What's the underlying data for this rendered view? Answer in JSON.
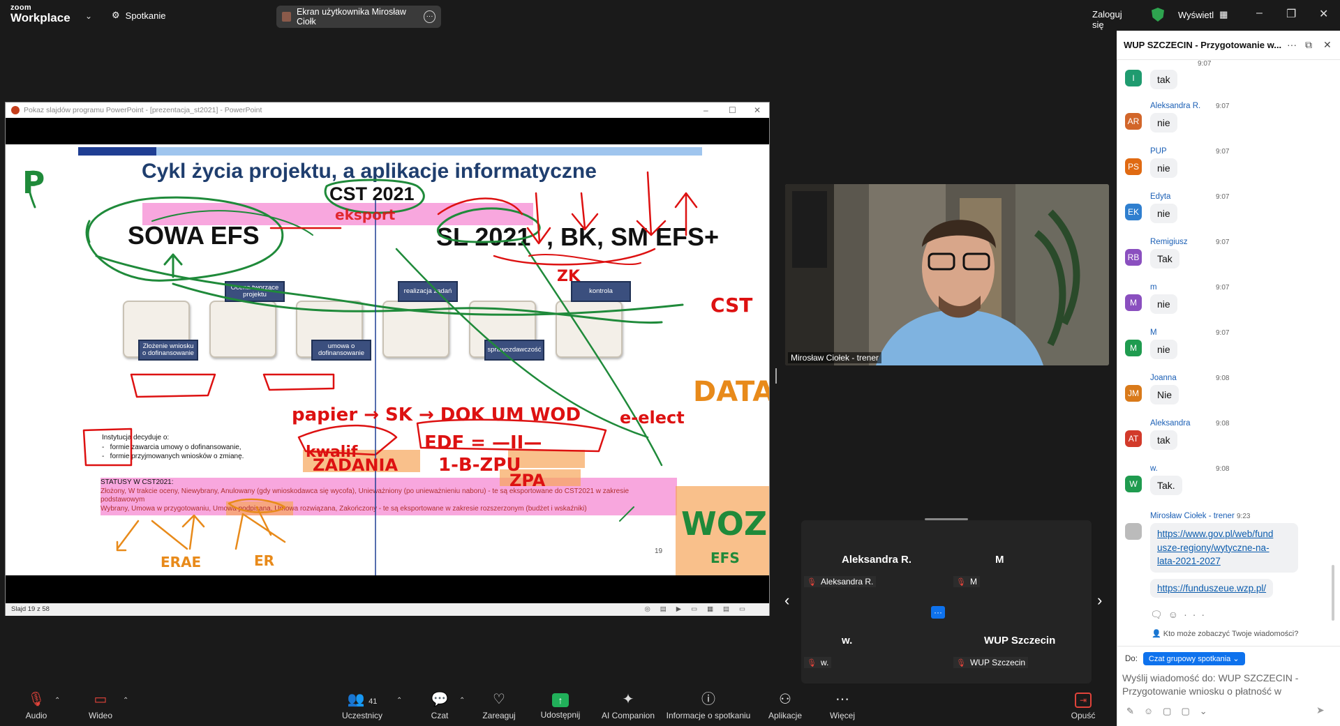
{
  "app": {
    "logo_top": "zoom",
    "logo_bottom": "Workplace",
    "meeting_label": "Spotkanie",
    "share_pill": "Ekran użytkownika Mirosław Ciołk",
    "signin": "Zaloguj się",
    "view": "Wyświetl"
  },
  "ppt": {
    "window_title": "Pokaz slajdów programu PowerPoint - [prezentacja_st2021] - PowerPoint",
    "status_left": "Slajd 19 z 58",
    "slide": {
      "title": "Cykl życia projektu, a aplikacje informatyczne",
      "cst": "CST 2021",
      "sowa": "SOWA EFS",
      "sl": "SL 2021",
      "bk": ", BK, SM EFS+",
      "stages": [
        "Złożenie wniosku o dofinansowanie",
        "Ocena tworzące projektu",
        "umowa o dofinansowanie",
        "realizacja zadań",
        "sprawozdawczość",
        "kontrola"
      ],
      "inst_title": "Instytucja decyduje o:",
      "inst_items": [
        "formie zawarcia umowy o dofinansowanie,",
        "formie przyjmowanych wniosków o zmianę."
      ],
      "statusy_title": "STATUSY W CST2021:",
      "statusy_line1": "Złożony, W trakcie oceny, Niewybrany, Anulowany (gdy wnioskodawca się wycofa), Unieważniony (po unieważnieniu naboru) - te są eksportowane do CST2021 w zakresie podstawowym",
      "statusy_line2": "Wybrany, Umowa w przygotowaniu, Umowa podpisana, Umowa rozwiązana, Zakończony -  te są eksportowane w zakresie rozszerzonym (budżet i wskaźniki)",
      "page": "19",
      "ink": {
        "p": "P",
        "ekspor": "eksport",
        "zk": "ZK",
        "cst_r": "CST",
        "data": "DATA",
        "papier": "papier → SK → DOK UM WOD",
        "kwalif": "kwalif",
        "edf": "EDF = —II—",
        "elect": "e-elect",
        "zadania": "ZADANIA",
        "ibzpu": "1-B-ZPU",
        "zpa": "ZPA",
        "woz": "WOZ",
        "efs": "EFS",
        "erae": "ERAE",
        "er": "ER"
      }
    }
  },
  "video": {
    "name": "Mirosław Ciołek - trener"
  },
  "gallery": {
    "tiles": [
      {
        "big": "Aleksandra R.",
        "small": "Aleksandra R."
      },
      {
        "big": "M",
        "small": "M"
      },
      {
        "big": "w.",
        "small": "w."
      },
      {
        "big": "WUP Szczecin",
        "small": "WUP Szczecin"
      }
    ],
    "more": "···"
  },
  "chat": {
    "title": "WUP SZCZECIN - Przygotowanie w...",
    "top_time": "9:07",
    "messages": [
      {
        "initials": "I",
        "color": "#1f9b6f",
        "sender": "",
        "time": "",
        "text": "tak"
      },
      {
        "initials": "AR",
        "color": "#d2662a",
        "sender": "Aleksandra R.",
        "time": "9:07",
        "text": "nie"
      },
      {
        "initials": "PS",
        "color": "#e06a12",
        "sender": "PUP",
        "time": "9:07",
        "text": "nie"
      },
      {
        "initials": "EK",
        "color": "#2f7fcf",
        "sender": "Edyta",
        "time": "9:07",
        "text": "nie"
      },
      {
        "initials": "RB",
        "color": "#8a4fbf",
        "sender": "Remigiusz",
        "time": "9:07",
        "text": "Tak"
      },
      {
        "initials": "M",
        "color": "#8a4fbf",
        "sender": "m",
        "time": "9:07",
        "text": "nie"
      },
      {
        "initials": "M",
        "color": "#1f9b4f",
        "sender": "M",
        "time": "9:07",
        "text": "nie"
      },
      {
        "initials": "JM",
        "color": "#d97a1a",
        "sender": "Joanna",
        "time": "9:08",
        "text": "Nie"
      },
      {
        "initials": "AT",
        "color": "#d23a2a",
        "sender": "Aleksandra",
        "time": "9:08",
        "text": "tak"
      },
      {
        "initials": "W",
        "color": "#1f9b4f",
        "sender": "w.",
        "time": "9:08",
        "text": "Tak."
      }
    ],
    "trainer": {
      "sender": "Mirosław Ciołek - trener",
      "time": "9:23",
      "link1": "https://www.gov.pl/web/fundusze-regiony/wytyczne-na-lata-2021-2027",
      "link1_lines": [
        "https://www.gov.pl/web/fund",
        "usze-regiony/wytyczne-na-",
        "lata-2021-2027"
      ],
      "link2": "https://funduszeue.wzp.pl/"
    },
    "who_can_see": "Kto może zobaczyć Twoje wiadomości?",
    "to_label": "Do:",
    "to_value": "Czat grupowy spotkania",
    "compose_placeholder": "Wyślij wiadomość do: WUP SZCZECIN - Przygotowanie wniosku o płatność w"
  },
  "toolbar": {
    "audio": "Audio",
    "video": "Wideo",
    "participants": "Uczestnicy",
    "participants_count": "41",
    "chat": "Czat",
    "react": "Zareaguj",
    "share": "Udostępnij",
    "ai": "AI Companion",
    "info": "Informacje o spotkaniu",
    "apps": "Aplikacje",
    "more": "Więcej",
    "leave": "Opuść"
  },
  "icons": [
    "mic-muted-icon",
    "video-off-icon",
    "participants-icon",
    "chat-icon",
    "react-icon",
    "share-icon",
    "ai-companion-icon",
    "info-icon",
    "apps-icon",
    "more-icon",
    "leave-icon",
    "shield-icon",
    "popout-icon",
    "close-icon"
  ],
  "colors": {
    "zoom_blue": "#0e72ed",
    "share_green": "#21b05a",
    "mute_red": "#e0433a",
    "slide_title": "#1f3e6e"
  }
}
